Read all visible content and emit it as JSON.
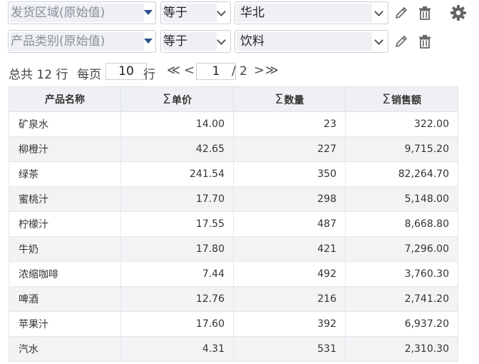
{
  "filters": [
    {
      "field": "发货区域(原始值)",
      "operator": "等于",
      "value": "华北"
    },
    {
      "field": "产品类别(原始值)",
      "operator": "等于",
      "value": "饮料"
    }
  ],
  "pagination": {
    "total_text": "总共 12 行",
    "per_page_label": "每页",
    "per_page_value": "10",
    "row_label": "行",
    "current_page": "1",
    "total_pages_text": "/ 2",
    "first_glyph": "≪",
    "prev_glyph": "<",
    "next_glyph": ">",
    "last_glyph": "≫"
  },
  "table": {
    "sigma_glyph": "Σ",
    "columns": [
      "产品名称",
      "单价",
      "数量",
      "销售额"
    ],
    "rows": [
      [
        "矿泉水",
        "14.00",
        "23",
        "322.00"
      ],
      [
        "柳橙汁",
        "42.65",
        "227",
        "9,715.20"
      ],
      [
        "绿茶",
        "241.54",
        "350",
        "82,264.70"
      ],
      [
        "蜜桃汁",
        "17.70",
        "298",
        "5,148.00"
      ],
      [
        "柠檬汁",
        "17.55",
        "487",
        "8,668.80"
      ],
      [
        "牛奶",
        "17.80",
        "421",
        "7,296.00"
      ],
      [
        "浓缩咖啡",
        "7.44",
        "492",
        "3,760.30"
      ],
      [
        "啤酒",
        "12.76",
        "216",
        "2,741.20"
      ],
      [
        "苹果汁",
        "17.60",
        "392",
        "6,937.20"
      ],
      [
        "汽水",
        "4.31",
        "531",
        "2,310.30"
      ]
    ]
  },
  "icons": {
    "edit": "pencil-icon",
    "delete": "trash-icon",
    "settings": "gear-icon"
  },
  "colors": {
    "caret": "#2a4f8a",
    "header_bg": "#eef0f3",
    "row_alt_bg": "#f2f3f5",
    "icon": "#666666"
  }
}
